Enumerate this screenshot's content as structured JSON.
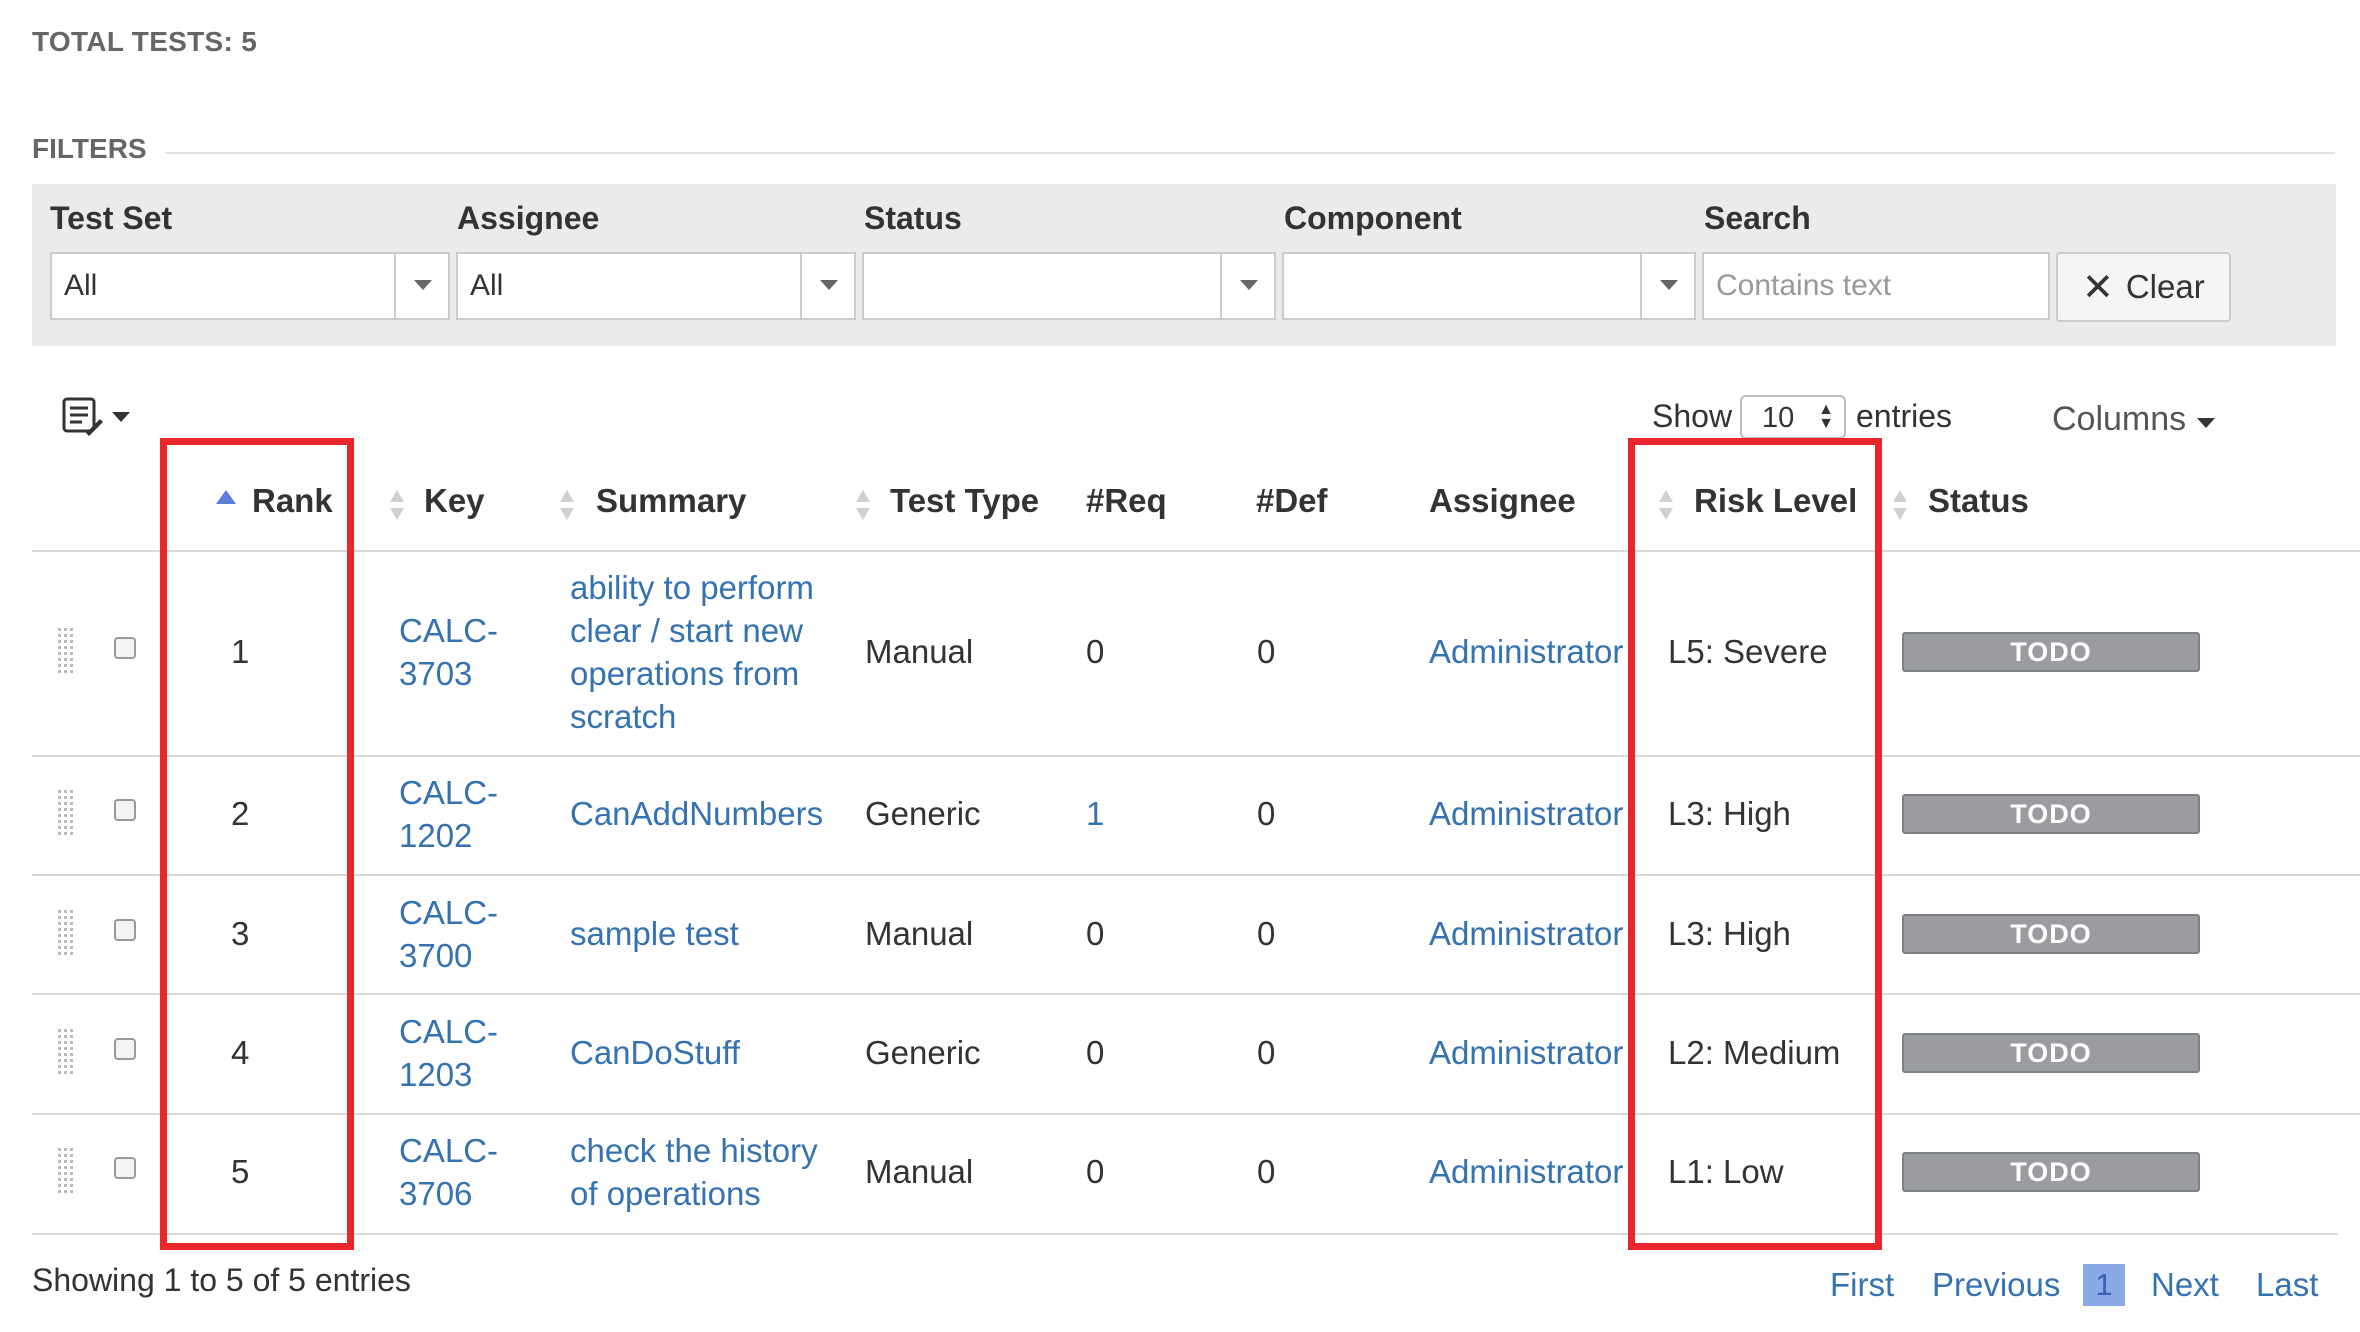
{
  "header": {
    "total_tests": "TOTAL TESTS: 5"
  },
  "filters": {
    "legend": "FILTERS",
    "test_set": {
      "label": "Test Set",
      "value": "All"
    },
    "assignee": {
      "label": "Assignee",
      "value": "All"
    },
    "status": {
      "label": "Status",
      "value": ""
    },
    "component": {
      "label": "Component",
      "value": ""
    },
    "search": {
      "label": "Search",
      "placeholder": "Contains text",
      "value": ""
    },
    "clear_label": "Clear"
  },
  "table_controls": {
    "show_label": "Show",
    "page_size": "10",
    "entries_label": "entries",
    "columns_label": "Columns"
  },
  "columns": [
    "Rank",
    "Key",
    "Summary",
    "Test Type",
    "#Req",
    "#Def",
    "Assignee",
    "Risk Level",
    "Status"
  ],
  "rows": [
    {
      "rank": "1",
      "key": [
        "CALC-",
        "3703"
      ],
      "summary": [
        "ability to perform",
        "clear / start new",
        "operations from",
        "scratch"
      ],
      "test_type": "Manual",
      "req": "0",
      "def": "0",
      "assignee": "Administrator",
      "risk_level": "L5: Severe",
      "status": "TODO"
    },
    {
      "rank": "2",
      "key": [
        "CALC-",
        "1202"
      ],
      "summary": [
        "CanAddNumbers"
      ],
      "test_type": "Generic",
      "req": "1",
      "def": "0",
      "assignee": "Administrator",
      "risk_level": "L3: High",
      "status": "TODO"
    },
    {
      "rank": "3",
      "key": [
        "CALC-",
        "3700"
      ],
      "summary": [
        "sample test"
      ],
      "test_type": "Manual",
      "req": "0",
      "def": "0",
      "assignee": "Administrator",
      "risk_level": "L3: High",
      "status": "TODO"
    },
    {
      "rank": "4",
      "key": [
        "CALC-",
        "1203"
      ],
      "summary": [
        "CanDoStuff"
      ],
      "test_type": "Generic",
      "req": "0",
      "def": "0",
      "assignee": "Administrator",
      "risk_level": "L2: Medium",
      "status": "TODO"
    },
    {
      "rank": "5",
      "key": [
        "CALC-",
        "3706"
      ],
      "summary": [
        "check the history",
        "of operations"
      ],
      "test_type": "Manual",
      "req": "0",
      "def": "0",
      "assignee": "Administrator",
      "risk_level": "L1: Low",
      "status": "TODO"
    }
  ],
  "footer": {
    "showing": "Showing 1 to 5 of 5 entries",
    "pager": {
      "first": "First",
      "previous": "Previous",
      "current": "1",
      "next": "Next",
      "last": "Last"
    }
  },
  "colors": {
    "link": "#3572b0",
    "highlight": "#e8262b",
    "badge": "#9a9ca0",
    "filter_bar": "#ebebeb"
  },
  "icons": [
    "table-settings-icon",
    "chevron-down-icon",
    "sort-ascending-icon",
    "sort-icon",
    "drag-handle-icon",
    "close-icon"
  ]
}
